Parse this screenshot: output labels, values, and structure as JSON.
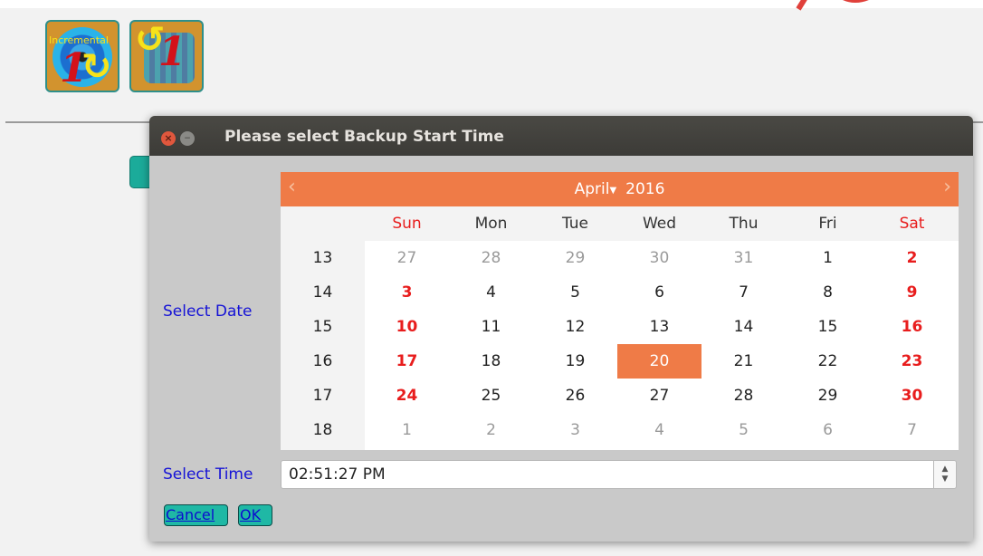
{
  "toolbar": {
    "buttons": [
      {
        "name": "incremental-backup",
        "caption": "Incremental",
        "icon": "incremental-backup-icon"
      },
      {
        "name": "incremental-restore",
        "caption": "",
        "icon": "incremental-restore-icon"
      }
    ]
  },
  "dialog": {
    "title": "Please select Backup Start Time",
    "select_date_label": "Select Date",
    "select_time_label": "Select Time",
    "calendar": {
      "month": "April",
      "year": "2016",
      "day_headers": [
        "Sun",
        "Mon",
        "Tue",
        "Wed",
        "Thu",
        "Fri",
        "Sat"
      ],
      "weeks": [
        {
          "week": "13",
          "days": [
            "27",
            "28",
            "29",
            "30",
            "31",
            "1",
            "2"
          ]
        },
        {
          "week": "14",
          "days": [
            "3",
            "4",
            "5",
            "6",
            "7",
            "8",
            "9"
          ]
        },
        {
          "week": "15",
          "days": [
            "10",
            "11",
            "12",
            "13",
            "14",
            "15",
            "16"
          ]
        },
        {
          "week": "16",
          "days": [
            "17",
            "18",
            "19",
            "20",
            "21",
            "22",
            "23"
          ]
        },
        {
          "week": "17",
          "days": [
            "24",
            "25",
            "26",
            "27",
            "28",
            "29",
            "30"
          ]
        },
        {
          "week": "18",
          "days": [
            "1",
            "2",
            "3",
            "4",
            "5",
            "6",
            "7"
          ]
        }
      ],
      "selected_day": "20",
      "colors": {
        "header": "#ef7b47",
        "weekend": "#e81d1d",
        "other_month": "#9a9a9a"
      }
    },
    "time_value": "02:51:27 PM",
    "buttons": {
      "cancel": "Cancel",
      "ok": "OK"
    }
  }
}
